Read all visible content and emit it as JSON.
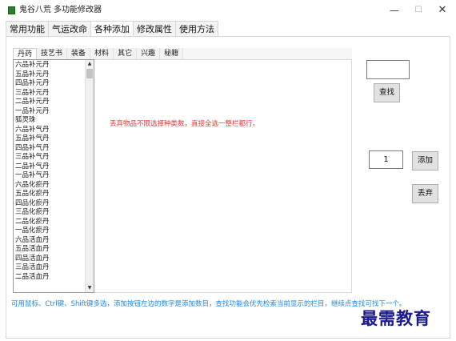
{
  "window": {
    "title": "鬼谷八荒 多功能修改器",
    "minimize": "—",
    "maximize": "☐",
    "close": "✕"
  },
  "outer_tabs": [
    "常用功能",
    "气运改命",
    "各种添加",
    "修改属性",
    "使用方法"
  ],
  "outer_tab_active": "各种添加",
  "inner_tabs": [
    "丹药",
    "技艺书",
    "装备",
    "材料",
    "其它",
    "兴趣",
    "秘籍"
  ],
  "inner_tab_active": "丹药",
  "items": [
    "六品补元丹",
    "五品补元丹",
    "四品补元丹",
    "三品补元丹",
    "二品补元丹",
    "一品补元丹",
    "狐灵珠",
    "六品补气丹",
    "五品补气丹",
    "四品补气丹",
    "三品补气丹",
    "二品补气丹",
    "一品补气丹",
    "六品化瘀丹",
    "五品化瘀丹",
    "四品化瘀丹",
    "三品化瘀丹",
    "二品化瘀丹",
    "一品化瘀丹",
    "六品活血丹",
    "五品活血丹",
    "四品活血丹",
    "三品活血丹",
    "二品活血丹"
  ],
  "scrollbar": {
    "up": "▲",
    "down": "▼"
  },
  "notice": "丢弃物品不限选择种类数，直接全选一整栏都行。",
  "search": {
    "value": "",
    "button": "查找"
  },
  "quantity": {
    "value": "1"
  },
  "buttons": {
    "add": "添加",
    "discard": "丢弃"
  },
  "help_text": "可用鼠标、Ctrl键、Shift键多选，添加按钮左边的数字是添加数目，查找功能会优先检索当前显示的栏目，继续点查找可找下一个。",
  "watermark": "最需教育",
  "colors": {
    "notice": "#e53935",
    "help": "#1e88e5",
    "icon": "#2e7d32",
    "watermark": "#1a1a8c"
  }
}
